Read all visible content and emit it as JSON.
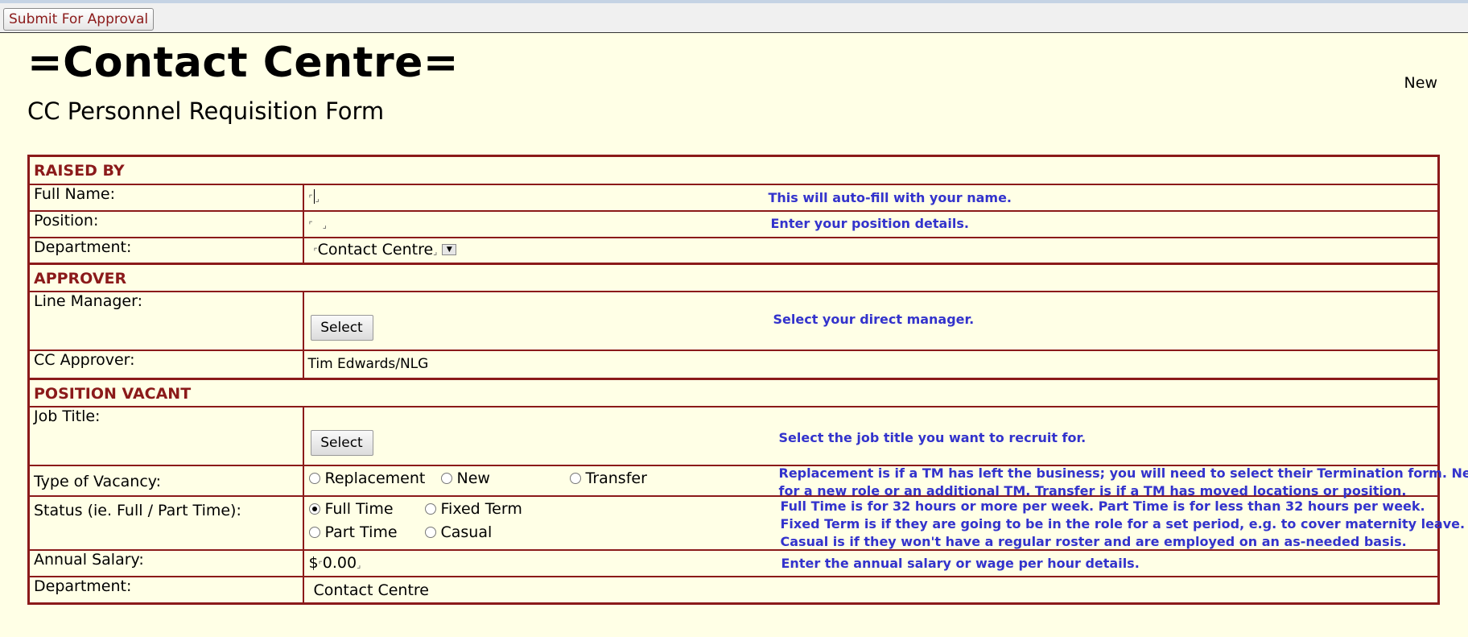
{
  "toolbar": {
    "submit_label": "Submit For Approval"
  },
  "header": {
    "title": "=Contact Centre=",
    "subtitle": "CC Personnel Requisition Form",
    "status": "New"
  },
  "sections": {
    "raised_by": "RAISED BY",
    "approver": "APPROVER",
    "position_vacant": "POSITION VACANT"
  },
  "fields": {
    "full_name": {
      "label": "Full Name:",
      "hint": "This will auto-fill with your name."
    },
    "position": {
      "label": "Position:",
      "hint": "Enter your position details."
    },
    "department": {
      "label": "Department:",
      "value": "Contact Centre"
    },
    "line_manager": {
      "label": "Line Manager:",
      "button": "Select",
      "hint": "Select your direct manager."
    },
    "cc_approver": {
      "label": "CC Approver:",
      "value": "Tim Edwards/NLG"
    },
    "job_title": {
      "label": "Job Title:",
      "button": "Select",
      "hint": "Select the job title you want to recruit for."
    },
    "vacancy_type": {
      "label": "Type of Vacancy:",
      "options": [
        "Replacement",
        "New",
        "Transfer"
      ],
      "hint1": "Replacement is if a TM has left the business; you will need to select their Termination form. New is",
      "hint2": "for a new role or an additional TM. Transfer is if a TM has moved locations or position."
    },
    "status": {
      "label": "Status (ie. Full / Part Time):",
      "options": [
        "Full Time",
        "Fixed Term",
        "Part Time",
        "Casual"
      ],
      "selected": "Full Time",
      "hint1": "Full Time is for 32 hours or more per week. Part Time is for less than 32 hours per week.",
      "hint2": "Fixed Term is if they are going to be in the role for a set period, e.g. to cover maternity leave.",
      "hint3": "Casual is if they won't have a regular roster and are employed on an as-needed basis."
    },
    "annual_salary": {
      "label": "Annual Salary:",
      "prefix": "$",
      "value": "0.00",
      "hint": "Enter the annual salary or wage per hour details."
    },
    "department_2": {
      "label": "Department:",
      "value": "Contact Centre"
    }
  },
  "colors": {
    "accent": "#8b1a1a",
    "hint": "#3333cc",
    "background": "#ffffe6"
  }
}
